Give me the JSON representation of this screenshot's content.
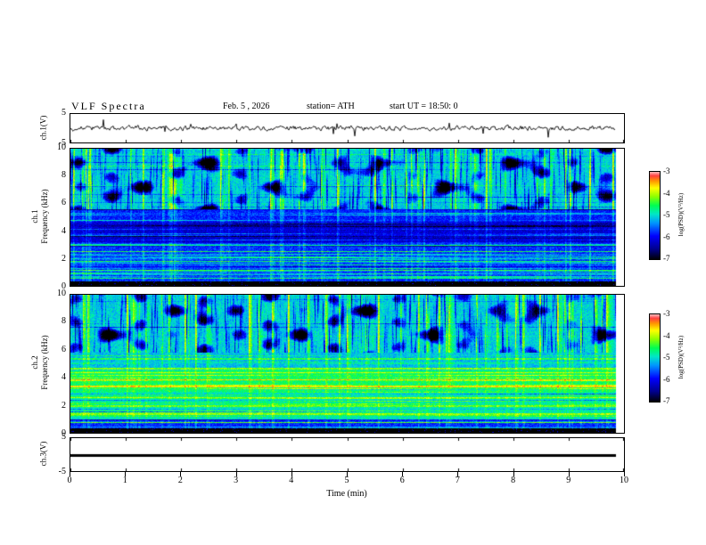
{
  "header": {
    "title": "VLF Spectra",
    "date": "Feb. 5 , 2026",
    "station": "station= ATH",
    "start_ut": "start UT =  18:50: 0"
  },
  "x_axis": {
    "label": "Time (min)",
    "ticks": [
      "0",
      "1",
      "2",
      "3",
      "4",
      "5",
      "6",
      "7",
      "8",
      "9",
      "10"
    ]
  },
  "panels": {
    "ch1v": {
      "label": "ch.1(V)",
      "ticks": [
        "5",
        "-5"
      ]
    },
    "ch1spec": {
      "label_lines": [
        "ch.1",
        "Frequency (kHz)"
      ],
      "ticks": [
        "10",
        "8",
        "6",
        "4",
        "2",
        "0"
      ]
    },
    "ch2spec": {
      "label_lines": [
        "ch.2",
        "Frequency (kHz)"
      ],
      "ticks": [
        "10",
        "8",
        "6",
        "4",
        "2",
        "0"
      ]
    },
    "ch3v": {
      "label": "ch.3(V)",
      "ticks": [
        "5",
        "-5"
      ]
    }
  },
  "colorbar": {
    "label": "log(PSD)(V²/Hz)",
    "ticks": [
      "-3",
      "-4",
      "-5",
      "-6",
      "-7"
    ]
  },
  "colormap": {
    "stops": [
      [
        0.0,
        "#000000"
      ],
      [
        0.12,
        "#00008c"
      ],
      [
        0.27,
        "#0000ff"
      ],
      [
        0.42,
        "#0096ff"
      ],
      [
        0.52,
        "#00e6c8"
      ],
      [
        0.62,
        "#00ff50"
      ],
      [
        0.72,
        "#8cff00"
      ],
      [
        0.82,
        "#ffff00"
      ],
      [
        0.9,
        "#ff9600"
      ],
      [
        0.96,
        "#ff4040"
      ],
      [
        1.0,
        "#ffb4b4"
      ]
    ]
  },
  "chart_data": [
    {
      "type": "line",
      "name": "ch1_waveform",
      "ylabel": "ch.1(V)",
      "xlabel": "Time (min)",
      "xlim": [
        0,
        10
      ],
      "ylim": [
        -5,
        5
      ],
      "data_end_min": 9.83,
      "baseline_v": 0,
      "noise_amplitude_v": 0.9,
      "spike_amplitude_v": 3,
      "seed": 99,
      "description": "continuous broadband noise trace centred on 0 V with ~±1 V fluctuations and sporadic ±2-3 V spikes across the full 0-9.83 min record"
    },
    {
      "type": "heatmap",
      "name": "ch1_spectrogram",
      "ylabel": "Frequency (kHz)",
      "xlim": [
        0,
        10
      ],
      "ylim": [
        0,
        10
      ],
      "zlim": [
        -7,
        -3
      ],
      "zlabel": "log(PSD)(V²/Hz)",
      "seed": 12345,
      "bands": [
        {
          "f": [
            0,
            0.35
          ],
          "level": -7,
          "line_prob": 0,
          "line_boost": [
            0,
            0
          ],
          "dark_line_prob": 0,
          "sferic": 0
        },
        {
          "f": [
            0.35,
            3.2
          ],
          "level": -5.75,
          "line_prob": 0.4,
          "line_boost": [
            0.5,
            1.2
          ],
          "dark_line_prob": 0.1,
          "sferic": 0.35
        },
        {
          "f": [
            3.2,
            4.7
          ],
          "level": -6.2,
          "line_prob": 0.15,
          "line_boost": [
            0.3,
            0.8
          ],
          "dark_line_prob": 0.2,
          "sferic": 0.3
        },
        {
          "f": [
            4.7,
            5.6
          ],
          "level": -5.85,
          "line_prob": 0.25,
          "line_boost": [
            0.3,
            0.9
          ],
          "dark_line_prob": 0.1,
          "sferic": 0.45
        },
        {
          "f": [
            5.6,
            10
          ],
          "level": -5.05,
          "line_prob": 0.05,
          "line_boost": [
            0.2,
            0.5
          ],
          "dark_line_prob": 0.05,
          "sferic": 0.95,
          "dark_patches": true
        }
      ],
      "strong_rows": [
        {
          "f": 0.55,
          "level": -4.6
        },
        {
          "f": 1.15,
          "level": -4.5
        },
        {
          "f": 1.8,
          "level": -4.6
        },
        {
          "f": 2.5,
          "level": -4.55
        },
        {
          "f": 2.95,
          "level": -4.7
        }
      ],
      "description": "spectrogram 0-10 kHz: black band below ~0.35 kHz; blue 0.4-3 kHz region laced with thin cyan-green harmonic lines; dark-blue quiet band 3-4.7 kHz; speckled cyan-green 5.6-10 kHz region crossed by many dark-blue vertical streaks and bright green-yellow full-height sferic streaks"
    },
    {
      "type": "heatmap",
      "name": "ch2_spectrogram",
      "ylabel": "Frequency (kHz)",
      "xlim": [
        0,
        10
      ],
      "ylim": [
        0,
        10
      ],
      "zlim": [
        -7,
        -3
      ],
      "zlabel": "log(PSD)(V²/Hz)",
      "seed": 777,
      "bands": [
        {
          "f": [
            0,
            0.3
          ],
          "level": -7,
          "line_prob": 0,
          "line_boost": [
            0,
            0
          ],
          "dark_line_prob": 0,
          "sferic": 0
        },
        {
          "f": [
            0.3,
            0.95
          ],
          "level": -5.8,
          "line_prob": 0.3,
          "line_boost": [
            0.4,
            1.0
          ],
          "dark_line_prob": 0.1,
          "sferic": 0.3
        },
        {
          "f": [
            0.95,
            3.0
          ],
          "level": -4.9,
          "line_prob": 0.45,
          "line_boost": [
            0.3,
            0.9
          ],
          "dark_line_prob": 0.15,
          "sferic": 0.25
        },
        {
          "f": [
            3.0,
            4.7
          ],
          "level": -4.6,
          "line_prob": 0.3,
          "line_boost": [
            0.3,
            0.8
          ],
          "dark_line_prob": 0.12,
          "sferic": 0.25
        },
        {
          "f": [
            4.7,
            5.8
          ],
          "level": -5.15,
          "line_prob": 0.25,
          "line_boost": [
            0.3,
            0.7
          ],
          "dark_line_prob": 0.1,
          "sferic": 0.5
        },
        {
          "f": [
            5.8,
            10
          ],
          "level": -5.05,
          "line_prob": 0.05,
          "line_boost": [
            0.2,
            0.5
          ],
          "dark_line_prob": 0.05,
          "sferic": 0.95,
          "dark_patches": true
        }
      ],
      "strong_rows": [
        {
          "f": 0.75,
          "level": -4.3
        },
        {
          "f": 1.35,
          "level": -4.15
        },
        {
          "f": 1.95,
          "level": -4.25
        },
        {
          "f": 2.55,
          "level": -4.05
        },
        {
          "f": 3.35,
          "level": -3.7
        },
        {
          "f": 3.85,
          "level": -3.65
        },
        {
          "f": 4.35,
          "level": -4.0
        },
        {
          "f": 4.65,
          "level": -4.2
        },
        {
          "f": 5.35,
          "level": -4.5
        }
      ],
      "description": "spectrogram 0-10 kHz: black band below ~0.3 kHz; dense green-yellow horizontal line structure 1-4.7 kHz with a few intense yellow-orange lines near 3.3-3.9 kHz; green-cyan band 4.7-5.8 kHz; upper 5.8-10 kHz region like ch.1 with dark-blue vertical streaks and bright sferic streaks"
    },
    {
      "type": "line",
      "name": "ch3_waveform",
      "ylabel": "ch.3(V)",
      "xlim": [
        0,
        10
      ],
      "ylim": [
        -5,
        5
      ],
      "data_end_min": 9.83,
      "baseline_v": 0,
      "noise_amplitude_v": 0,
      "description": "flat heavy black line at 0 V (no signal on channel 3)"
    }
  ]
}
